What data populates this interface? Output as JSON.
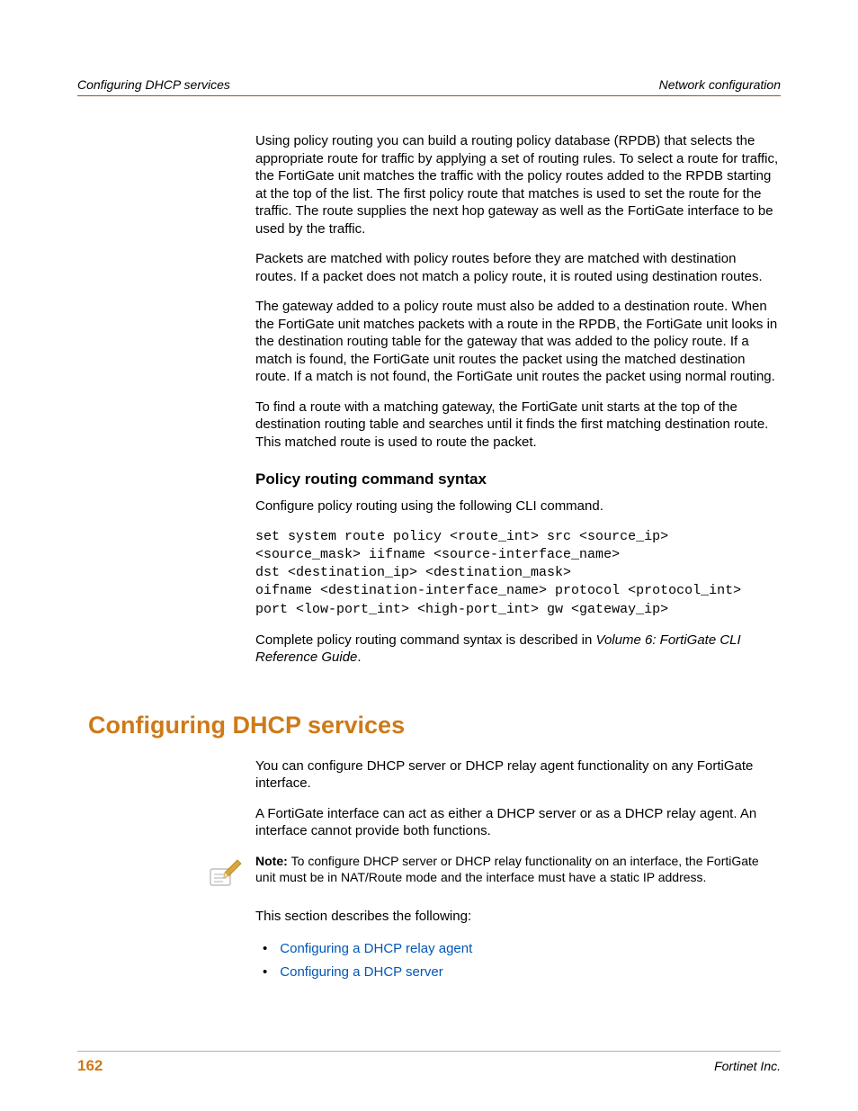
{
  "header": {
    "left": "Configuring DHCP services",
    "right": "Network configuration"
  },
  "body": {
    "p1": "Using policy routing you can build a routing policy database (RPDB) that selects the appropriate route for traffic by applying a set of routing rules. To select a route for traffic, the FortiGate unit matches the traffic with the policy routes added to the RPDB starting at the top of the list. The first policy route that matches is used to set the route for the traffic. The route supplies the next hop gateway as well as the FortiGate interface to be used by the traffic.",
    "p2": "Packets are matched with policy routes before they are matched with destination routes. If a packet does not match a policy route, it is routed using destination routes.",
    "p3": "The gateway added to a policy route must also be added to a destination route. When the FortiGate unit matches packets with a route in the RPDB, the FortiGate unit looks in the destination routing table for the gateway that was added to the policy route. If a match is found, the FortiGate unit routes the packet using the matched destination route. If a match is not found, the FortiGate unit routes the packet using normal routing.",
    "p4": "To find a route with a matching gateway, the FortiGate unit starts at the top of the destination routing table and searches until it finds the first matching destination route. This matched route is used to route the packet.",
    "sub1": "Policy routing command syntax",
    "p5": "Configure policy routing using the following CLI command.",
    "code": "set system route policy <route_int> src <source_ip>\n<source_mask> iifname <source-interface_name>\ndst <destination_ip> <destination_mask>\noifname <destination-interface_name> protocol <protocol_int>\nport <low-port_int> <high-port_int> gw <gateway_ip>",
    "p6a": "Complete policy routing command syntax is described in ",
    "p6b": "Volume 6: FortiGate CLI Reference Guide",
    "p6c": ".",
    "h1": "Configuring DHCP services",
    "p7": "You can configure DHCP server or DHCP relay agent functionality on any FortiGate interface.",
    "p8": "A FortiGate interface can act as either a DHCP server or as a DHCP relay agent. An interface cannot provide both functions.",
    "note_label": "Note: ",
    "note_body": "To configure DHCP server or DHCP relay functionality on an interface, the FortiGate unit must be in NAT/Route mode and the interface must have a static IP address.",
    "p9": "This section describes the following:",
    "link1": "Configuring a DHCP relay agent",
    "link2": "Configuring a DHCP server"
  },
  "footer": {
    "page": "162",
    "right": "Fortinet Inc."
  }
}
